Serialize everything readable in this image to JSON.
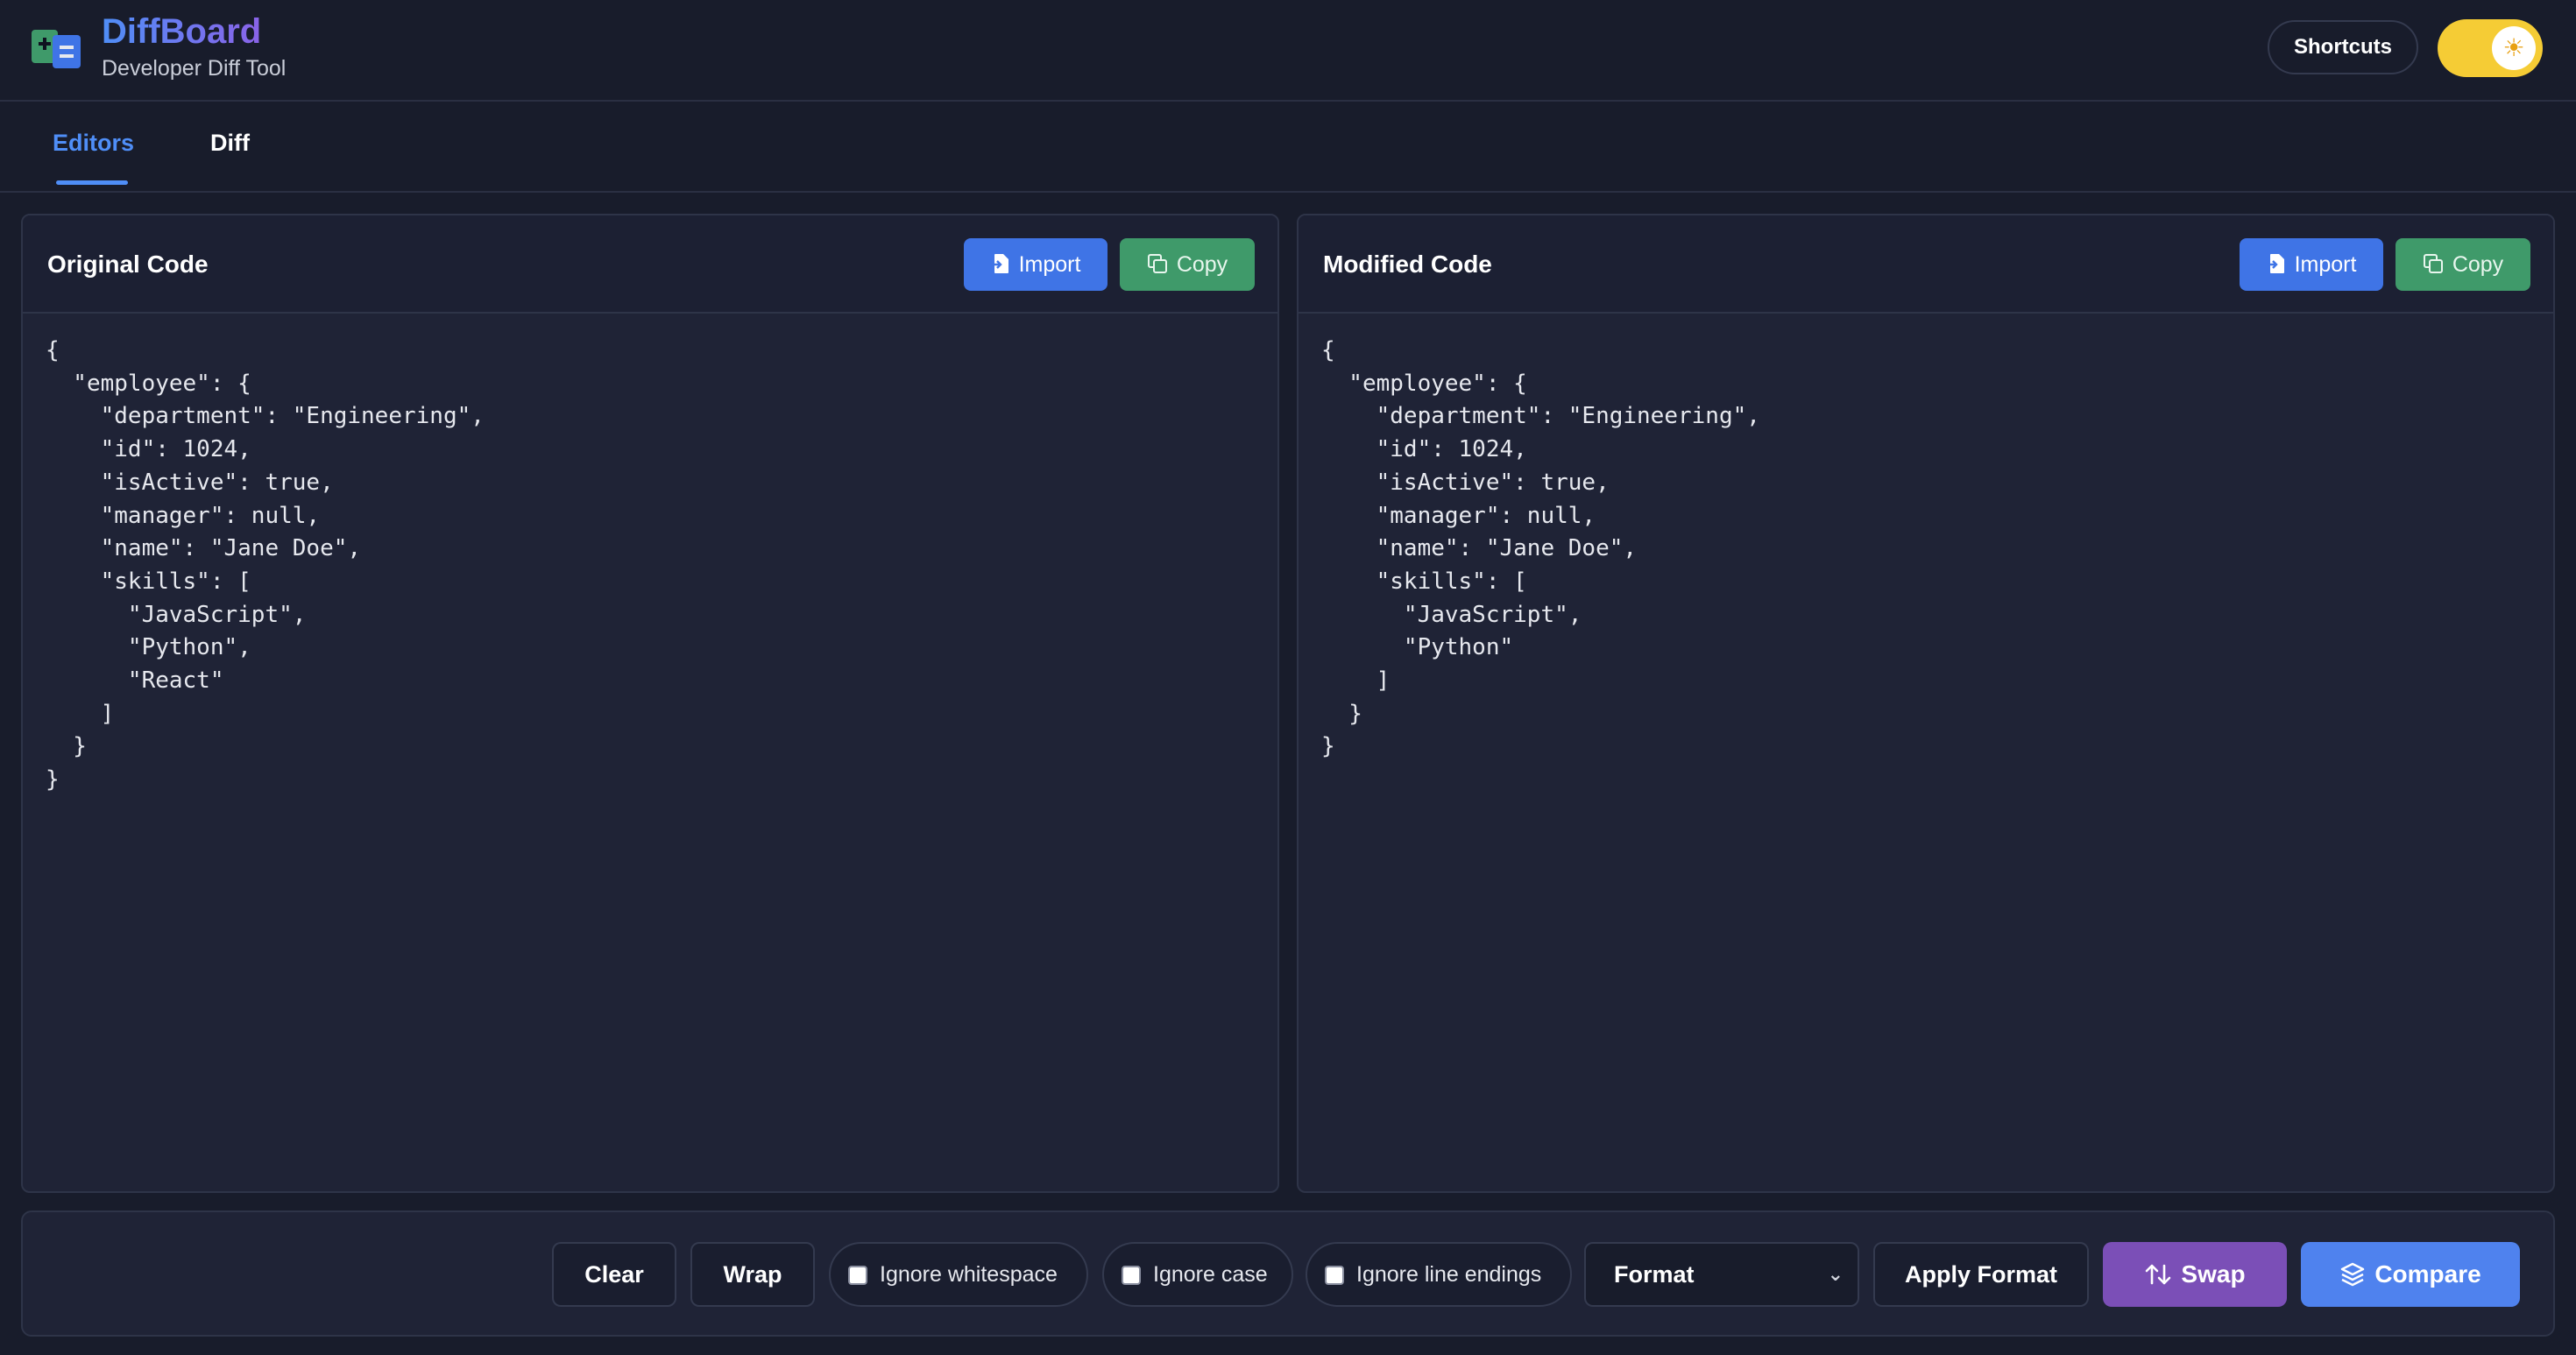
{
  "header": {
    "title": "DiffBoard",
    "subtitle": "Developer Diff Tool",
    "shortcuts_label": "Shortcuts",
    "theme_toggle_icon": "sun-icon",
    "logo_icon": "diff-logo-icon"
  },
  "tabs": [
    {
      "label": "Editors",
      "active": true
    },
    {
      "label": "Diff",
      "active": false
    }
  ],
  "panels": {
    "original": {
      "title": "Original Code",
      "import_label": "Import",
      "copy_label": "Copy",
      "code": "{\n  \"employee\": {\n    \"department\": \"Engineering\",\n    \"id\": 1024,\n    \"isActive\": true,\n    \"manager\": null,\n    \"name\": \"Jane Doe\",\n    \"skills\": [\n      \"JavaScript\",\n      \"Python\",\n      \"React\"\n    ]\n  }\n}"
    },
    "modified": {
      "title": "Modified Code",
      "import_label": "Import",
      "copy_label": "Copy",
      "code": "{\n  \"employee\": {\n    \"department\": \"Engineering\",\n    \"id\": 1024,\n    \"isActive\": true,\n    \"manager\": null,\n    \"name\": \"Jane Doe\",\n    \"skills\": [\n      \"JavaScript\",\n      \"Python\"\n    ]\n  }\n}"
    }
  },
  "toolbar": {
    "clear_label": "Clear",
    "wrap_label": "Wrap",
    "ignore_whitespace_label": "Ignore whitespace",
    "ignore_case_label": "Ignore case",
    "ignore_line_endings_label": "Ignore line endings",
    "format_selected": "Format",
    "apply_format_label": "Apply Format",
    "swap_label": "Swap",
    "compare_label": "Compare"
  },
  "colors": {
    "accent_blue": "#4f8ef7",
    "copy_green": "#3f9a6a",
    "swap_purple": "#7b4fb7",
    "toggle_yellow": "#f5cc35",
    "background": "#181c2b"
  }
}
